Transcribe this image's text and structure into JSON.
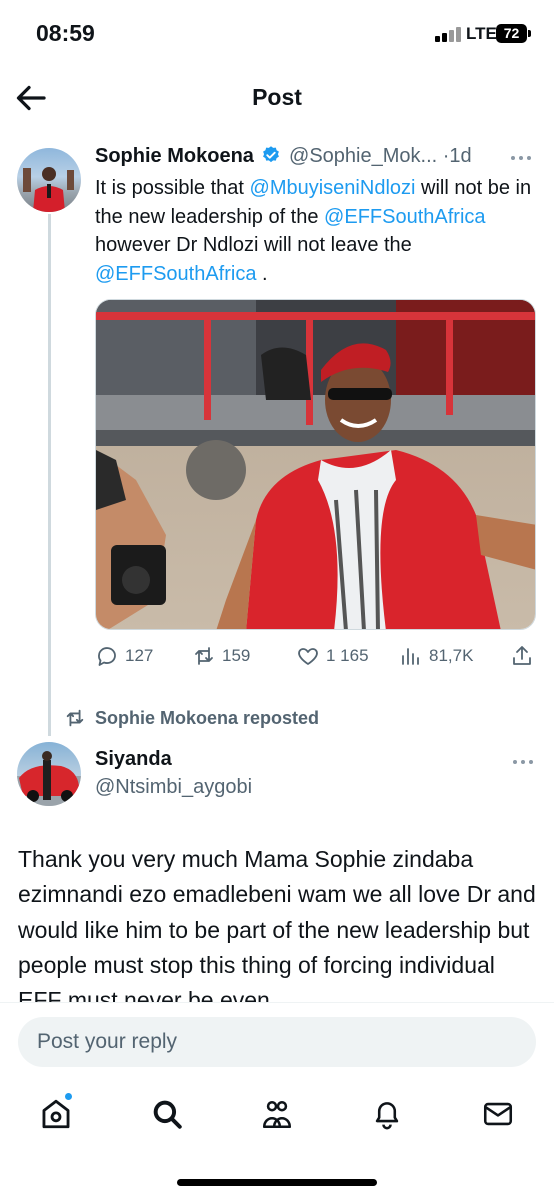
{
  "status_bar": {
    "time": "08:59",
    "network": "LTE",
    "battery": "72"
  },
  "nav": {
    "title": "Post",
    "back_icon": "arrow-left-icon"
  },
  "post": {
    "author_name": "Sophie Mokoena",
    "handle": "@Sophie_Mok...",
    "time_sep": "·",
    "time": "1d",
    "verified": true,
    "text_parts": [
      {
        "text": "It is possible that ",
        "type": "text"
      },
      {
        "text": "@MbuyiseniNdlozi",
        "type": "mention"
      },
      {
        "text": " will not be in the new leadership of the ",
        "type": "text"
      },
      {
        "text": "@EFFSouthAfrica",
        "type": "mention"
      },
      {
        "text": " however Dr Ndlozi will not leave the ",
        "type": "text"
      },
      {
        "text": "@EFFSouthAfrica",
        "type": "mention"
      },
      {
        "text": " .",
        "type": "text"
      }
    ],
    "stats": {
      "replies": "127",
      "reposts": "159",
      "likes": "1 165",
      "views": "81,7K"
    }
  },
  "repost_label": "Sophie Mokoena reposted",
  "reply": {
    "author_name": "Siyanda",
    "handle": "@Ntsimbi_aygobi",
    "text": "Thank you very much Mama Sophie zindaba ezimnandi ezo emadlebeni wam we all love Dr and would like him to be part of the new leadership but people must stop this thing of forcing individual EFF must never be even"
  },
  "composer": {
    "placeholder": "Post your reply"
  },
  "tabbar": {
    "tabs": [
      "home",
      "search",
      "communities",
      "notifications",
      "messages"
    ]
  },
  "colors": {
    "accent": "#1d9bf0",
    "secondary_text": "#536471",
    "primary_text": "#0f1419"
  }
}
